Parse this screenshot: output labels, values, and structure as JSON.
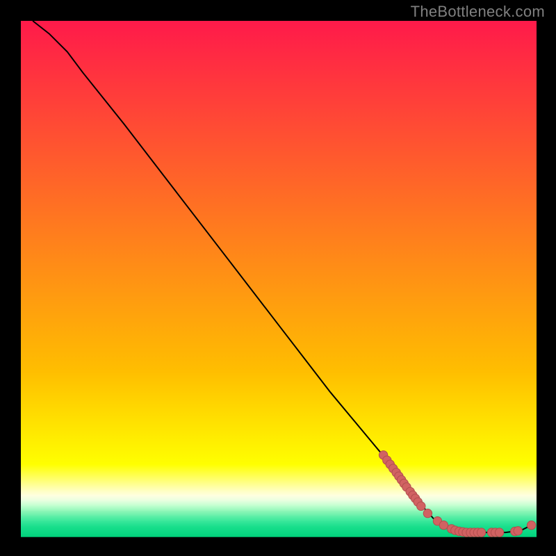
{
  "watermark": "TheBottleneck.com",
  "chart_data": {
    "type": "line",
    "title": "",
    "xlabel": "",
    "ylabel": "",
    "xlim": [
      0,
      100
    ],
    "ylim": [
      0,
      100
    ],
    "curve": [
      {
        "x": 2.3,
        "y": 100
      },
      {
        "x": 5.5,
        "y": 97.5
      },
      {
        "x": 9.0,
        "y": 94.0
      },
      {
        "x": 12.0,
        "y": 90.0
      },
      {
        "x": 20.0,
        "y": 80.0
      },
      {
        "x": 30.0,
        "y": 67.0
      },
      {
        "x": 40.0,
        "y": 54.0
      },
      {
        "x": 50.0,
        "y": 41.0
      },
      {
        "x": 60.0,
        "y": 28.0
      },
      {
        "x": 70.0,
        "y": 16.0
      },
      {
        "x": 76.0,
        "y": 8.0
      },
      {
        "x": 80.0,
        "y": 3.5
      },
      {
        "x": 83.0,
        "y": 1.5
      },
      {
        "x": 86.0,
        "y": 0.8
      },
      {
        "x": 90.0,
        "y": 0.8
      },
      {
        "x": 94.0,
        "y": 0.8
      },
      {
        "x": 97.0,
        "y": 1.2
      },
      {
        "x": 99.0,
        "y": 2.2
      }
    ],
    "scatter": [
      {
        "x": 70.3,
        "y": 15.8
      },
      {
        "x": 71.0,
        "y": 14.8
      },
      {
        "x": 71.6,
        "y": 14.0
      },
      {
        "x": 72.2,
        "y": 13.2
      },
      {
        "x": 72.8,
        "y": 12.4
      },
      {
        "x": 73.3,
        "y": 11.7
      },
      {
        "x": 73.8,
        "y": 11.0
      },
      {
        "x": 74.3,
        "y": 10.3
      },
      {
        "x": 74.8,
        "y": 9.6
      },
      {
        "x": 75.5,
        "y": 8.7
      },
      {
        "x": 76.0,
        "y": 8.0
      },
      {
        "x": 76.5,
        "y": 7.4
      },
      {
        "x": 77.0,
        "y": 6.7
      },
      {
        "x": 77.6,
        "y": 5.9
      },
      {
        "x": 78.9,
        "y": 4.5
      },
      {
        "x": 80.8,
        "y": 3.0
      },
      {
        "x": 82.0,
        "y": 2.2
      },
      {
        "x": 83.5,
        "y": 1.5
      },
      {
        "x": 84.2,
        "y": 1.2
      },
      {
        "x": 85.0,
        "y": 1.0
      },
      {
        "x": 85.7,
        "y": 0.9
      },
      {
        "x": 86.4,
        "y": 0.8
      },
      {
        "x": 87.2,
        "y": 0.8
      },
      {
        "x": 87.9,
        "y": 0.8
      },
      {
        "x": 88.6,
        "y": 0.8
      },
      {
        "x": 89.3,
        "y": 0.8
      },
      {
        "x": 91.3,
        "y": 0.8
      },
      {
        "x": 92.0,
        "y": 0.8
      },
      {
        "x": 92.8,
        "y": 0.8
      },
      {
        "x": 95.8,
        "y": 1.0
      },
      {
        "x": 96.4,
        "y": 1.1
      },
      {
        "x": 99.0,
        "y": 2.2
      }
    ],
    "gradient_bands": [
      {
        "y0": 100,
        "y1": 32,
        "c0": "#ff1a4a",
        "c1": "#ffbe00"
      },
      {
        "y0": 32,
        "y1": 14,
        "c0": "#ffbe00",
        "c1": "#ffff00"
      },
      {
        "y0": 14,
        "y1": 9,
        "c0": "#ffff00",
        "c1": "#ffffbf"
      },
      {
        "y0": 9,
        "y1": 8,
        "c0": "#ffffbf",
        "c1": "#ffffe0"
      },
      {
        "y0": 8,
        "y1": 7,
        "c0": "#ffffe0",
        "c1": "#e8ffe0"
      },
      {
        "y0": 7,
        "y1": 6,
        "c0": "#e8ffe0",
        "c1": "#c0ffcf"
      },
      {
        "y0": 6,
        "y1": 5,
        "c0": "#c0ffcf",
        "c1": "#90f7b8"
      },
      {
        "y0": 5,
        "y1": 4,
        "c0": "#90f7b8",
        "c1": "#60efa8"
      },
      {
        "y0": 4,
        "y1": 3,
        "c0": "#60efa8",
        "c1": "#38e79a"
      },
      {
        "y0": 3,
        "y1": 2,
        "c0": "#38e79a",
        "c1": "#1adf8d"
      },
      {
        "y0": 2,
        "y1": 0,
        "c0": "#1adf8d",
        "c1": "#00d37c"
      }
    ],
    "colors": {
      "scatter_fill": "#d16262",
      "scatter_stroke": "#b24e4e",
      "curve_stroke": "#000000",
      "background_border": "#000000"
    }
  }
}
